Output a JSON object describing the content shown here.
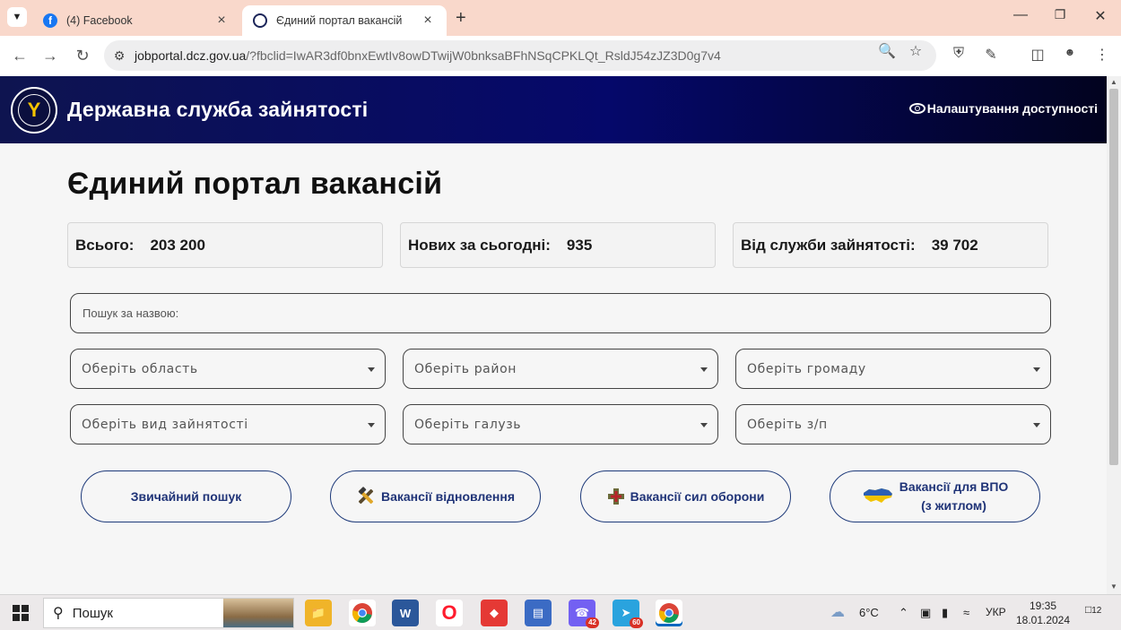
{
  "browser": {
    "tabs": [
      {
        "title": "(4) Facebook",
        "favicon": "facebook-icon"
      },
      {
        "title": "Єдиний портал вакансій",
        "favicon": "dsz-logo-icon"
      }
    ],
    "url_host": "jobportal.dcz.gov.ua",
    "url_rest": "/?fbclid=IwAR3df0bnxEwtIv8owDTwijW0bnksaBFhNSqCPKLQt_RsldJ54zJZ3D0g7v4"
  },
  "header": {
    "site_title": "Державна служба зайнятості",
    "accessibility_label": "Налаштування доступності"
  },
  "main": {
    "title": "Єдиний портал вакансій",
    "stats": [
      {
        "label": "Всього:",
        "value": "203 200"
      },
      {
        "label": "Нових за сьогодні:",
        "value": "935"
      },
      {
        "label": "Від служби зайнятості:",
        "value": "39 702"
      }
    ],
    "search_placeholder": "Пошук за назвою:",
    "filters": [
      "Оберіть область",
      "Оберіть район",
      "Оберіть громаду",
      "Оберіть вид зайнятості",
      "Оберіть галузь",
      "Оберіть з/п"
    ],
    "buttons": {
      "regular_search": "Звичайний пошук",
      "reconstruction": "Вакансії відновлення",
      "defense": "Вакансії сил оборони",
      "idp_line1": "Вакансії для ВПО",
      "idp_line2": "(з житлом)"
    }
  },
  "taskbar": {
    "search_label": "Пошук",
    "weather": "6°C",
    "language": "УКР",
    "time": "19:35",
    "date": "18.01.2024",
    "notifications": "12",
    "viber_badge": "42",
    "telegram_badge": "60"
  }
}
